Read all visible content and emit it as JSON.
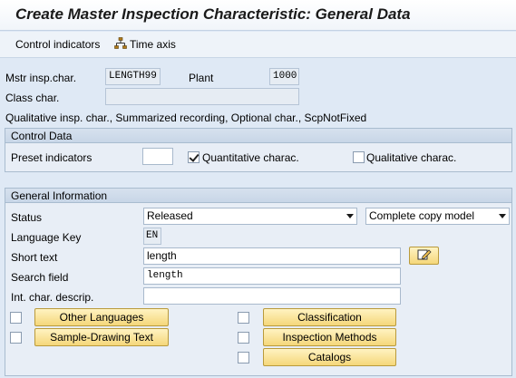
{
  "window": {
    "title": "Create Master Inspection Characteristic: General Data"
  },
  "toolbar": {
    "control_indicators": "Control indicators",
    "time_axis": "Time axis"
  },
  "header": {
    "mstr_label": "Mstr insp.char.",
    "mstr_value": "LENGTH99",
    "plant_label": "Plant",
    "plant_value": "1000",
    "class_label": "Class char.",
    "class_value": "",
    "summary": "Qualitative insp. char., Summarized recording, Optional char., ScpNotFixed"
  },
  "control_data": {
    "title": "Control Data",
    "preset_label": "Preset indicators",
    "preset_value": "",
    "quantitative_label": "Quantitative charac.",
    "quantitative_checked": true,
    "qualitative_label": "Qualitative charac.",
    "qualitative_checked": false
  },
  "general_info": {
    "title": "General Information",
    "status_label": "Status",
    "status_value": "Released",
    "copy_model_value": "Complete copy model",
    "language_label": "Language Key",
    "language_value": "EN",
    "short_text_label": "Short text",
    "short_text_value": "length",
    "search_label": "Search field",
    "search_value": "length",
    "int_desc_label": "Int. char. descrip.",
    "int_desc_value": ""
  },
  "buttons": {
    "other_languages": "Other Languages",
    "sample_drawing": "Sample-Drawing Text",
    "classification": "Classification",
    "inspection_methods": "Inspection Methods",
    "catalogs": "Catalogs"
  },
  "icons": {
    "time_axis": "hierarchy-icon",
    "edit_long_text": "pencil-edit-icon"
  }
}
